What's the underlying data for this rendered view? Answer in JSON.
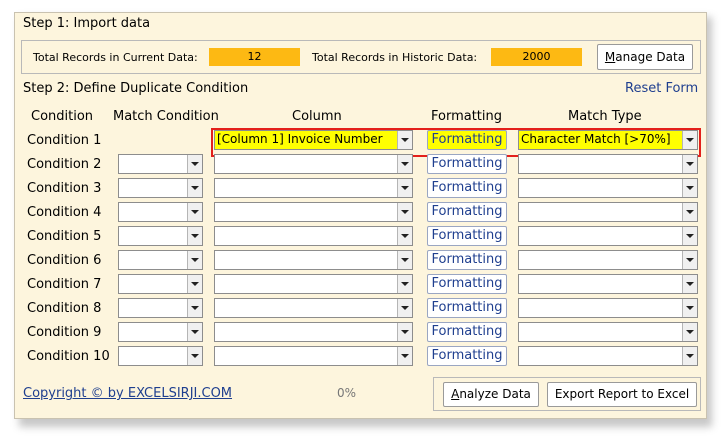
{
  "step1": {
    "title": "Step 1: Import data",
    "current_label": "Total Records in Current Data:",
    "current_value": "12",
    "historic_label": "Total Records in Historic Data:",
    "historic_value": "2000",
    "manage_button": {
      "accel": "M",
      "rest": "anage Data"
    }
  },
  "step2": {
    "title": "Step 2: Define Duplicate Condition",
    "reset_link": "Reset Form",
    "headers": {
      "condition": "Condition",
      "match_condition": "Match Condition",
      "column": "Column",
      "formatting": "Formatting",
      "match_type": "Match Type"
    },
    "rows": [
      {
        "label": "Condition 1",
        "match_condition": "",
        "column": "[Column 1] Invoice Number",
        "formatting": "Formatting",
        "match_type": "Character Match [>70%]"
      },
      {
        "label": "Condition 2",
        "match_condition": "",
        "column": "",
        "formatting": "Formatting",
        "match_type": ""
      },
      {
        "label": "Condition 3",
        "match_condition": "",
        "column": "",
        "formatting": "Formatting",
        "match_type": ""
      },
      {
        "label": "Condition 4",
        "match_condition": "",
        "column": "",
        "formatting": "Formatting",
        "match_type": ""
      },
      {
        "label": "Condition 5",
        "match_condition": "",
        "column": "",
        "formatting": "Formatting",
        "match_type": ""
      },
      {
        "label": "Condition 6",
        "match_condition": "",
        "column": "",
        "formatting": "Formatting",
        "match_type": ""
      },
      {
        "label": "Condition 7",
        "match_condition": "",
        "column": "",
        "formatting": "Formatting",
        "match_type": ""
      },
      {
        "label": "Condition 8",
        "match_condition": "",
        "column": "",
        "formatting": "Formatting",
        "match_type": ""
      },
      {
        "label": "Condition 9",
        "match_condition": "",
        "column": "",
        "formatting": "Formatting",
        "match_type": ""
      },
      {
        "label": "Condition 10",
        "match_condition": "",
        "column": "",
        "formatting": "Formatting",
        "match_type": ""
      }
    ]
  },
  "footer": {
    "copyright": "Copyright © by EXCELSIRJI.COM",
    "progress": "0%",
    "analyze_button": {
      "accel": "A",
      "rest": "nalyze Data"
    },
    "export_button": "Export Report to Excel"
  },
  "colors": {
    "background": "#fdf5dd",
    "count_fill": "#fdb913",
    "highlight_row": "#ffff00",
    "highlight_border": "#e3201b",
    "link": "#1f3f8f"
  }
}
